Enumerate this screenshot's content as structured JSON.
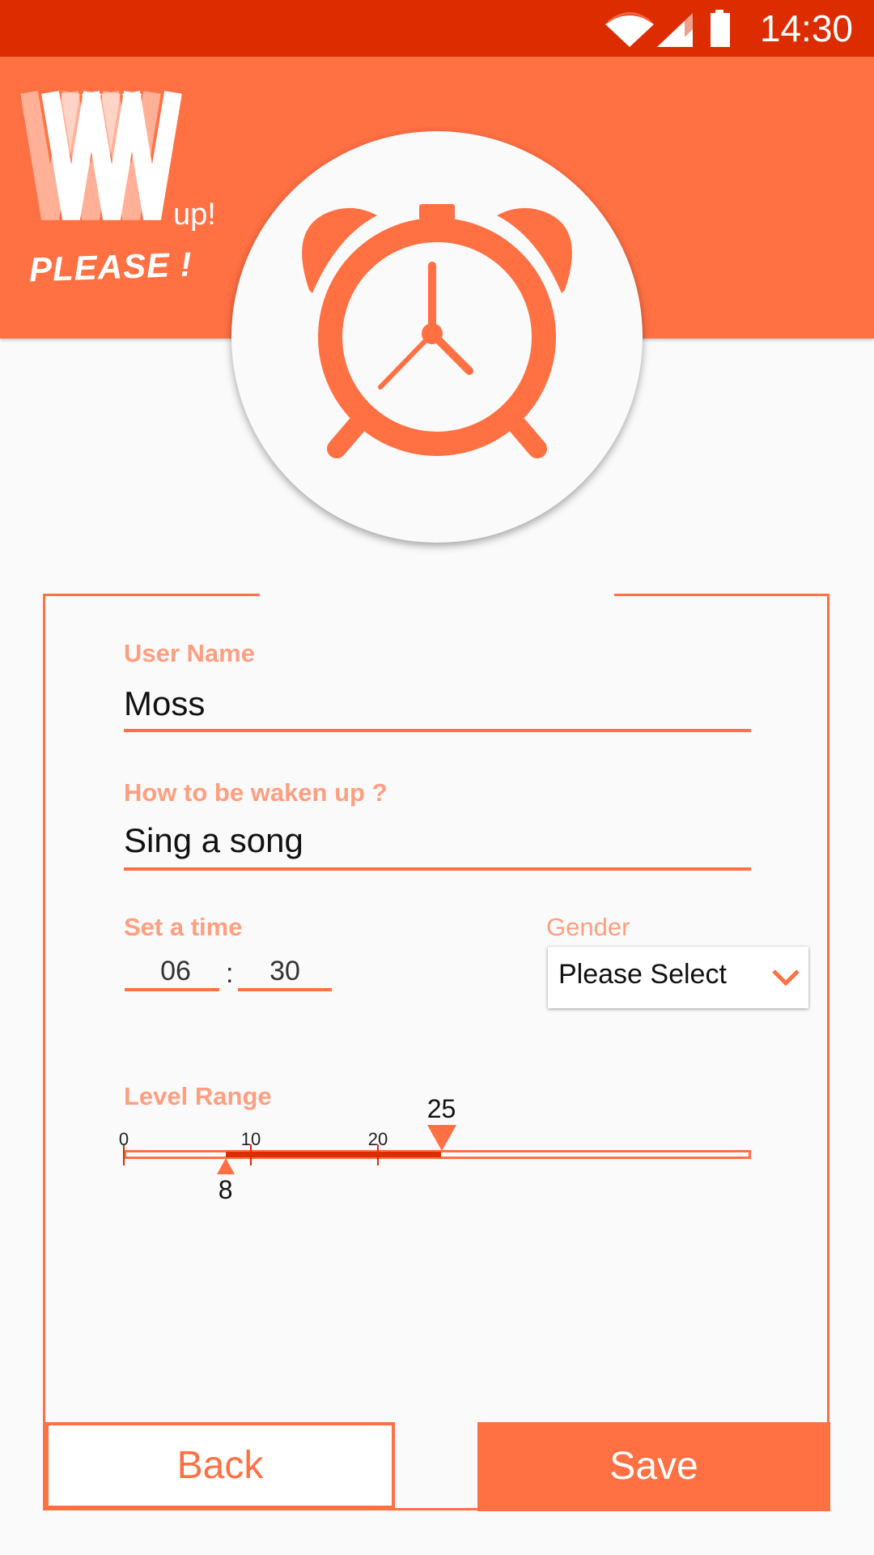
{
  "status_bar": {
    "time": "14:30",
    "icons": [
      "wifi-icon",
      "signal-icon",
      "battery-icon"
    ]
  },
  "logo": {
    "up_text": "up!",
    "tagline": "PLEASE !"
  },
  "form": {
    "username": {
      "label": "User Name",
      "value": "Moss"
    },
    "wake_method": {
      "label": "How to be waken up ?",
      "value": "Sing a song"
    },
    "time": {
      "label": "Set a time",
      "hour": "06",
      "separator": ":",
      "minute": "30"
    },
    "gender": {
      "label": "Gender",
      "selected": "Please Select"
    },
    "level_range": {
      "label": "Level Range",
      "ticks": [
        "0",
        "10",
        "20"
      ],
      "min_value": 0,
      "max_value": 50,
      "low": 8,
      "high": 25,
      "low_label": "8",
      "high_label": "25"
    }
  },
  "buttons": {
    "back": "Back",
    "save": "Save"
  },
  "colors": {
    "primary": "#ff7043",
    "dark": "#dd2c00",
    "label": "#ff9e80"
  }
}
